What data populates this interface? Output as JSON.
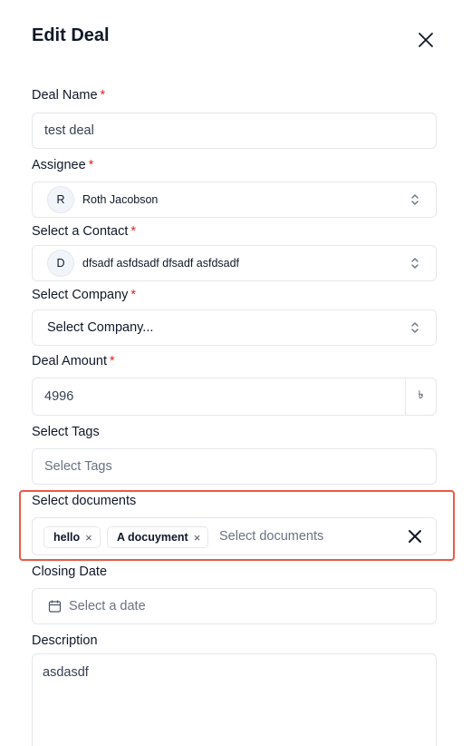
{
  "header": {
    "title": "Edit Deal"
  },
  "fields": {
    "deal_name": {
      "label": "Deal Name",
      "required": "*",
      "value": "test deal"
    },
    "assignee": {
      "label": "Assignee",
      "required": "*",
      "avatar_initial": "R",
      "value": "Roth Jacobson"
    },
    "contact": {
      "label": "Select a Contact",
      "required": "*",
      "avatar_initial": "D",
      "value": "dfsadf asfdsadf dfsadf asfdsadf"
    },
    "company": {
      "label": "Select Company",
      "required": "*",
      "placeholder": "Select Company..."
    },
    "amount": {
      "label": "Deal Amount",
      "required": "*",
      "value": "4996",
      "currency_symbol": "৳"
    },
    "tags": {
      "label": "Select Tags",
      "placeholder": "Select Tags"
    },
    "documents": {
      "label": "Select documents",
      "chips": [
        {
          "label": "hello",
          "remove": "×"
        },
        {
          "label": "A docuyment",
          "remove": "×"
        }
      ],
      "placeholder": "Select documents"
    },
    "closing_date": {
      "label": "Closing Date",
      "placeholder": "Select a date"
    },
    "description": {
      "label": "Description",
      "value": "asdasdf"
    }
  },
  "colors": {
    "required": "#dc2626",
    "highlight": "#ea5a45",
    "border": "#e5e7eb"
  }
}
